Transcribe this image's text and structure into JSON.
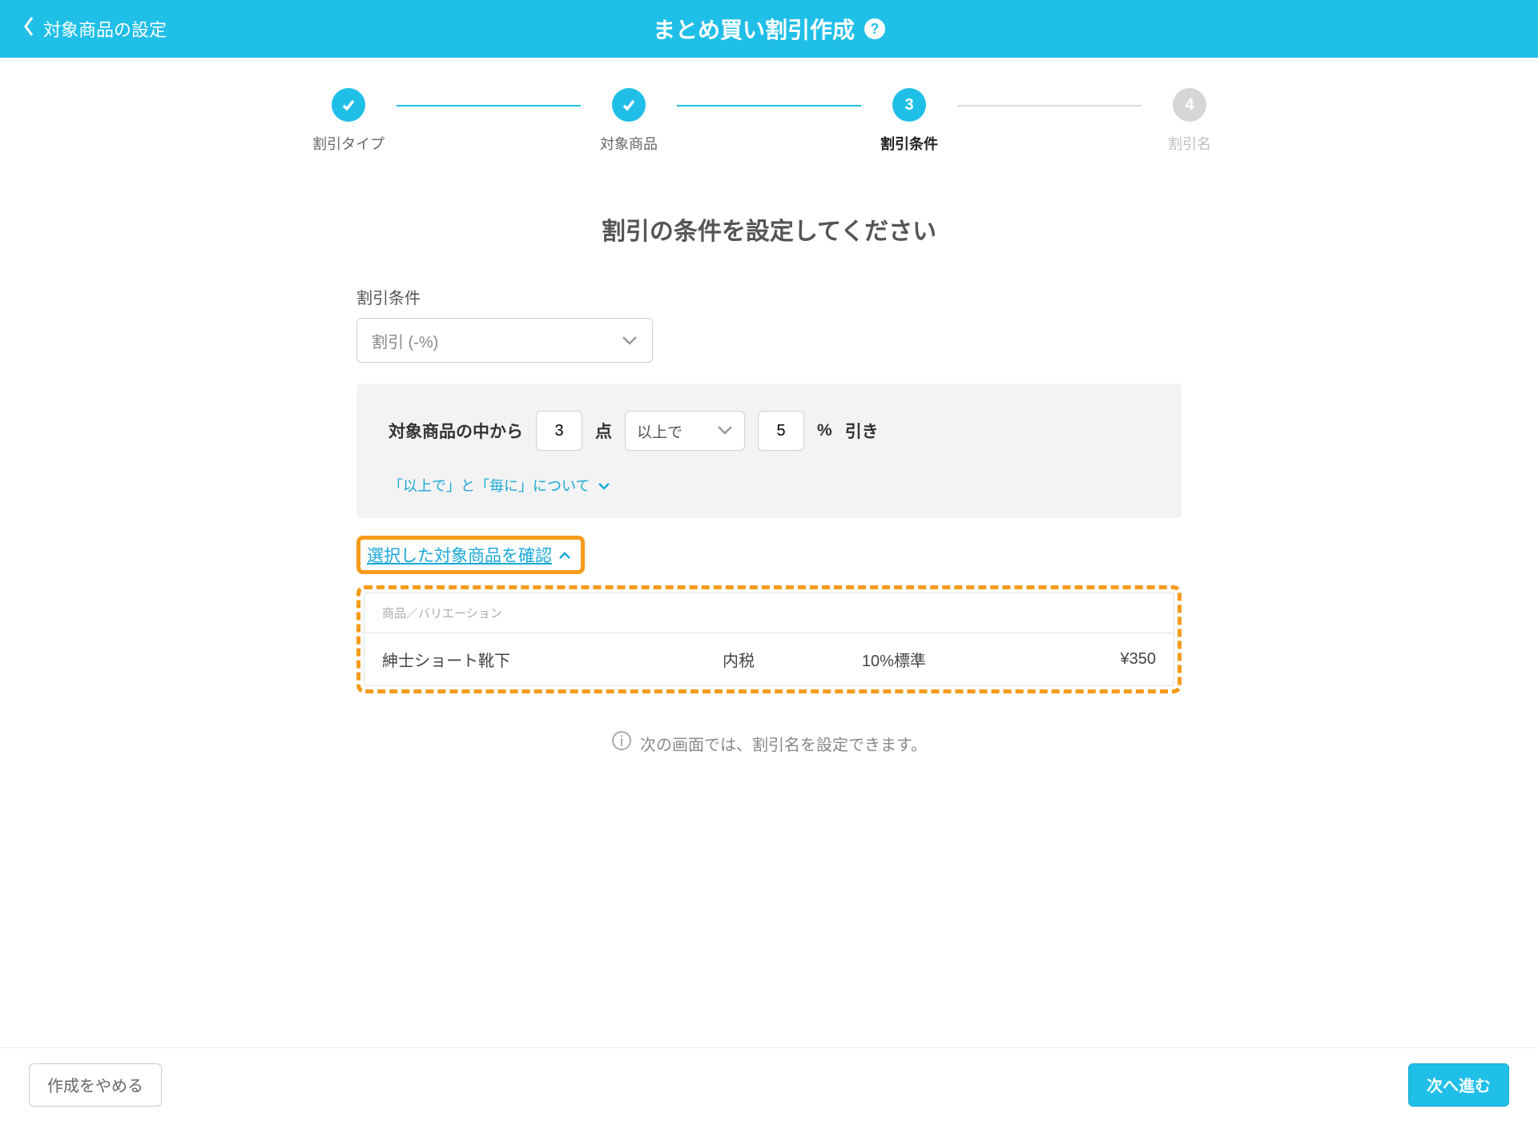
{
  "header": {
    "back_label": "対象商品の設定",
    "title": "まとめ買い割引作成"
  },
  "stepper": {
    "steps": [
      {
        "label": "割引タイプ",
        "state": "done"
      },
      {
        "label": "対象商品",
        "state": "done"
      },
      {
        "label": "割引条件",
        "state": "active",
        "number": "3"
      },
      {
        "label": "割引名",
        "state": "pending",
        "number": "4"
      }
    ]
  },
  "heading": "割引の条件を設定してください",
  "condition": {
    "section_label": "割引条件",
    "type_selected": "割引 (-%)",
    "prefix": "対象商品の中から",
    "qty_value": "3",
    "qty_unit": "点",
    "mode_selected": "以上で",
    "pct_value": "5",
    "pct_unit": "%",
    "suffix": "引き",
    "about_link": "「以上で」と「毎に」について"
  },
  "confirm": {
    "toggle_label": "選択した対象商品を確認"
  },
  "table": {
    "header": "商品／バリエーション",
    "rows": [
      {
        "name": "紳士ショート靴下",
        "tax": "内税",
        "rate": "10%標準",
        "price": "¥350"
      }
    ]
  },
  "info": "次の画面では、割引名を設定できます。",
  "footer": {
    "cancel": "作成をやめる",
    "next": "次へ進む"
  }
}
